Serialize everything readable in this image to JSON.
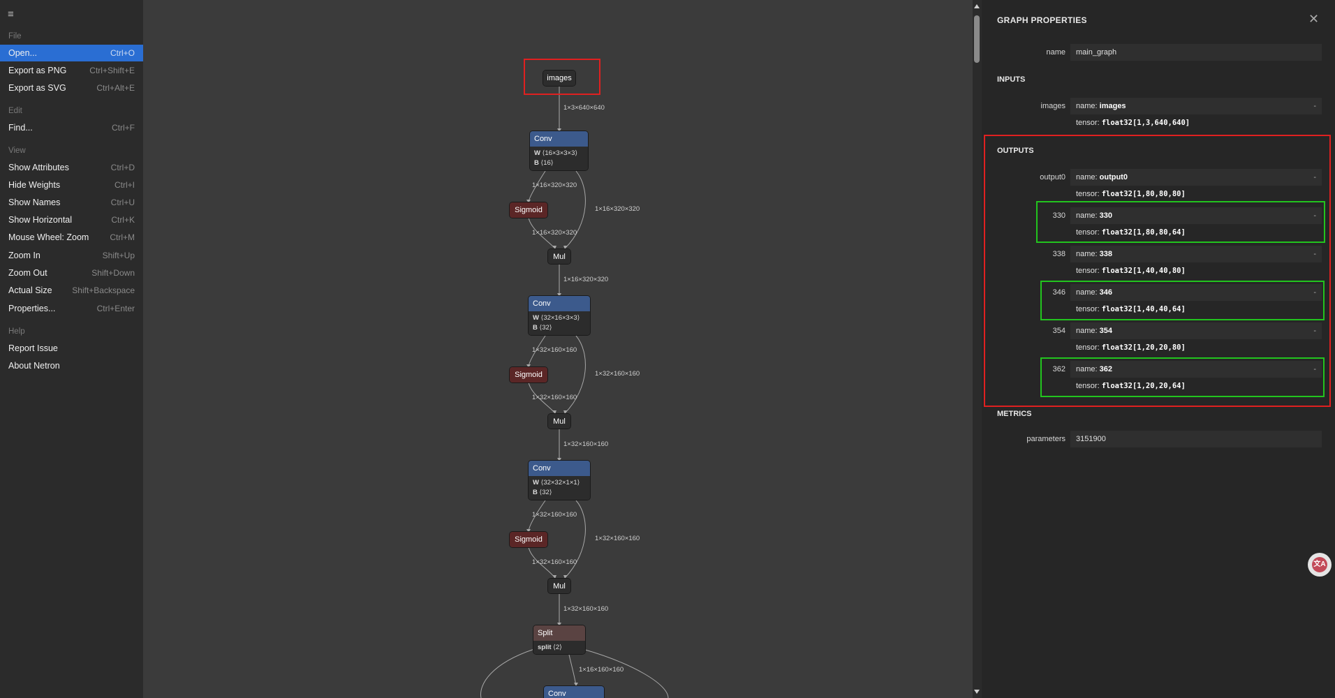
{
  "menu": {
    "toggle_icon": "≡",
    "groups": [
      {
        "title": "File",
        "items": [
          {
            "label": "Open...",
            "shortcut": "Ctrl+O"
          },
          {
            "label": "Export as PNG",
            "shortcut": "Ctrl+Shift+E"
          },
          {
            "label": "Export as SVG",
            "shortcut": "Ctrl+Alt+E"
          }
        ]
      },
      {
        "title": "Edit",
        "items": [
          {
            "label": "Find...",
            "shortcut": "Ctrl+F"
          }
        ]
      },
      {
        "title": "View",
        "items": [
          {
            "label": "Show Attributes",
            "shortcut": "Ctrl+D"
          },
          {
            "label": "Hide Weights",
            "shortcut": "Ctrl+I"
          },
          {
            "label": "Show Names",
            "shortcut": "Ctrl+U"
          },
          {
            "label": "Show Horizontal",
            "shortcut": "Ctrl+K"
          },
          {
            "label": "Mouse Wheel: Zoom",
            "shortcut": "Ctrl+M"
          },
          {
            "label": "Zoom In",
            "shortcut": "Shift+Up"
          },
          {
            "label": "Zoom Out",
            "shortcut": "Shift+Down"
          },
          {
            "label": "Actual Size",
            "shortcut": "Shift+Backspace"
          },
          {
            "label": "Properties...",
            "shortcut": "Ctrl+Enter"
          }
        ]
      },
      {
        "title": "Help",
        "items": [
          {
            "label": "Report Issue",
            "shortcut": ""
          },
          {
            "label": "About Netron",
            "shortcut": ""
          }
        ]
      }
    ]
  },
  "graph": {
    "input_node": "images",
    "edges": {
      "e1": "1×3×640×640",
      "e2a": "1×16×320×320",
      "e2b": "1×16×320×320",
      "e2c": "1×16×320×320",
      "e3": "1×16×320×320",
      "e4a": "1×32×160×160",
      "e4b": "1×32×160×160",
      "e4c": "1×32×160×160",
      "e5": "1×32×160×160",
      "e6a": "1×32×160×160",
      "e6b": "1×32×160×160",
      "e6c": "1×32×160×160",
      "e7": "1×32×160×160",
      "e8": "1×16×160×160"
    },
    "conv1": {
      "op": "Conv",
      "w_key": "W",
      "w": "⟨16×3×3×3⟩",
      "b_key": "B",
      "b": "⟨16⟩"
    },
    "conv2": {
      "op": "Conv",
      "w_key": "W",
      "w": "⟨32×16×3×3⟩",
      "b_key": "B",
      "b": "⟨32⟩"
    },
    "conv3": {
      "op": "Conv",
      "w_key": "W",
      "w": "⟨32×32×1×1⟩",
      "b_key": "B",
      "b": "⟨32⟩"
    },
    "conv4": {
      "op": "Conv"
    },
    "sigmoid": "Sigmoid",
    "mul": "Mul",
    "split": {
      "op": "Split",
      "attr_key": "split",
      "attr_val": "⟨2⟩"
    }
  },
  "panel": {
    "title": "GRAPH PROPERTIES",
    "close_icon": "✕",
    "name_label": "name",
    "name_value": "main_graph",
    "inputs_title": "INPUTS",
    "inputs": [
      {
        "label": "images",
        "name": "images",
        "tensor": "float32[1,3,640,640]"
      }
    ],
    "outputs_title": "OUTPUTS",
    "outputs": [
      {
        "label": "output0",
        "name": "output0",
        "tensor": "float32[1,80,80,80]"
      },
      {
        "label": "330",
        "name": "330",
        "tensor": "float32[1,80,80,64]"
      },
      {
        "label": "338",
        "name": "338",
        "tensor": "float32[1,40,40,80]"
      },
      {
        "label": "346",
        "name": "346",
        "tensor": "float32[1,40,40,64]"
      },
      {
        "label": "354",
        "name": "354",
        "tensor": "float32[1,20,20,80]"
      },
      {
        "label": "362",
        "name": "362",
        "tensor": "float32[1,20,20,64]"
      }
    ],
    "metrics_title": "METRICS",
    "parameters_label": "parameters",
    "parameters_value": "3151900",
    "name_prefix": "name: ",
    "tensor_prefix": "tensor: ",
    "dash": "-"
  },
  "fab_icon": "translate-icon",
  "fab_text": "文A"
}
